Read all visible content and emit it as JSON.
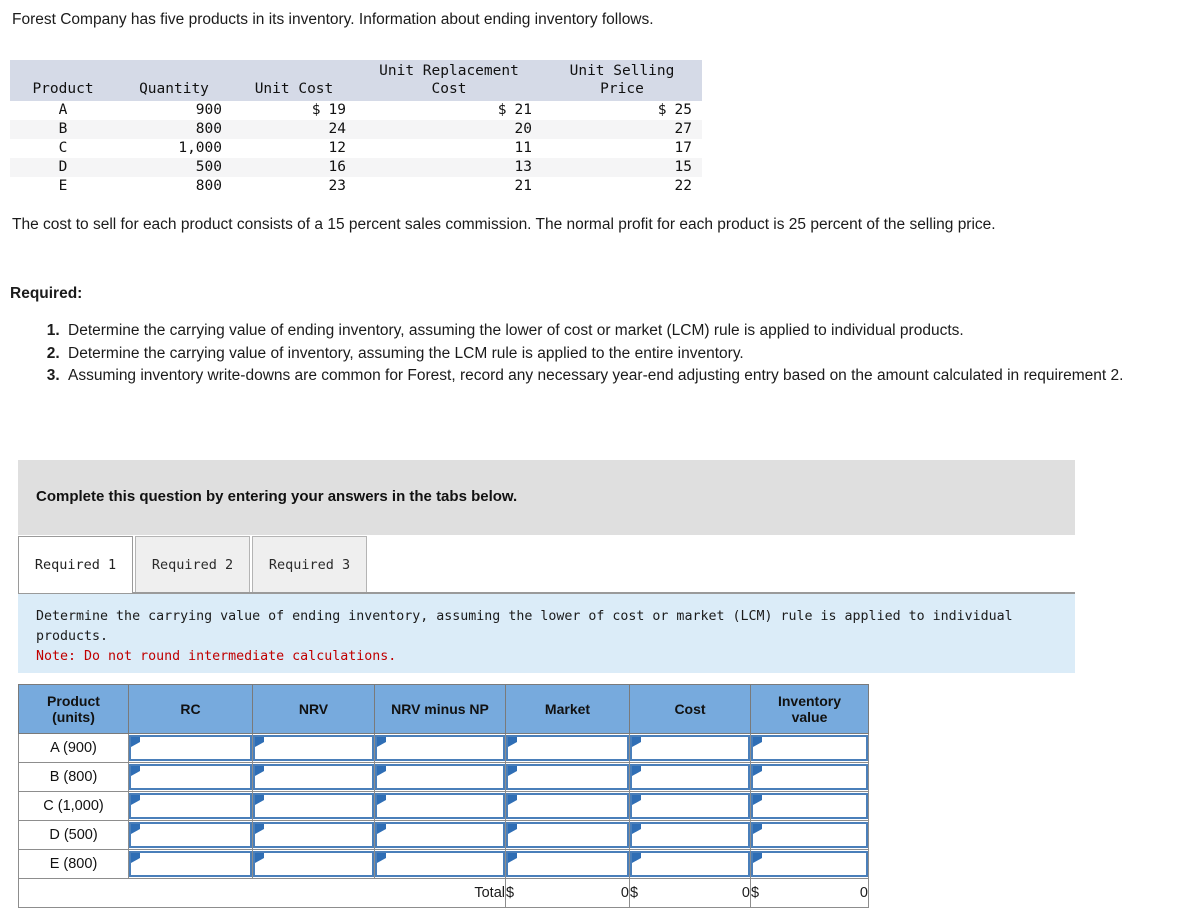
{
  "intro": "Forest Company has five products in its inventory. Information about ending inventory follows.",
  "inventory_table": {
    "headers": {
      "product": "Product",
      "quantity": "Quantity",
      "unit_cost": "Unit Cost",
      "unit_replacement_cost": "Unit Replacement Cost",
      "unit_selling_price": "Unit Selling Price"
    },
    "rows": [
      {
        "product": "A",
        "quantity": "900",
        "unit_cost": "19",
        "unit_cost_sym": "$",
        "rc": "21",
        "rc_sym": "$",
        "sp": "25",
        "sp_sym": "$"
      },
      {
        "product": "B",
        "quantity": "800",
        "unit_cost": "24",
        "unit_cost_sym": "",
        "rc": "20",
        "rc_sym": "",
        "sp": "27",
        "sp_sym": ""
      },
      {
        "product": "C",
        "quantity": "1,000",
        "unit_cost": "12",
        "unit_cost_sym": "",
        "rc": "11",
        "rc_sym": "",
        "sp": "17",
        "sp_sym": ""
      },
      {
        "product": "D",
        "quantity": "500",
        "unit_cost": "16",
        "unit_cost_sym": "",
        "rc": "13",
        "rc_sym": "",
        "sp": "15",
        "sp_sym": ""
      },
      {
        "product": "E",
        "quantity": "800",
        "unit_cost": "23",
        "unit_cost_sym": "",
        "rc": "21",
        "rc_sym": "",
        "sp": "22",
        "sp_sym": ""
      }
    ]
  },
  "cost_to_sell_paragraph": "The cost to sell for each product consists of a 15 percent sales commission. The normal profit for each product is 25 percent of the selling price.",
  "required_label": "Required:",
  "requirements": [
    "Determine the carrying value of ending inventory, assuming the lower of cost or market (LCM) rule is applied to individual products.",
    "Determine the carrying value of inventory, assuming the LCM rule is applied to the entire inventory.",
    "Assuming inventory write-downs are common for Forest, record any necessary year-end adjusting entry based on the amount calculated in requirement 2."
  ],
  "instruction_bar": {
    "text": "Complete this question by entering your answers in the tabs below."
  },
  "tabs": [
    {
      "label": "Required 1",
      "active": true
    },
    {
      "label": "Required 2",
      "active": false
    },
    {
      "label": "Required 3",
      "active": false
    }
  ],
  "note_panel": {
    "line1": "Determine the carrying value of ending inventory, assuming the lower of cost or market (LCM) rule is applied to individual",
    "line2": "products.",
    "note": "Note: Do not round intermediate calculations."
  },
  "answer_table": {
    "headers": {
      "product": "Product (units)",
      "product_line1": "Product",
      "product_line2": "(units)",
      "rc": "RC",
      "nrv": "NRV",
      "nrv_minus_np": "NRV minus NP",
      "market": "Market",
      "cost": "Cost",
      "inventory_value_line1": "Inventory",
      "inventory_value_line2": "value"
    },
    "rows": [
      {
        "product": "A (900)",
        "rc": "",
        "nrv": "",
        "nrv_minus_np": "",
        "market": "",
        "cost": "",
        "inventory_value": ""
      },
      {
        "product": "B (800)",
        "rc": "",
        "nrv": "",
        "nrv_minus_np": "",
        "market": "",
        "cost": "",
        "inventory_value": ""
      },
      {
        "product": "C (1,000)",
        "rc": "",
        "nrv": "",
        "nrv_minus_np": "",
        "market": "",
        "cost": "",
        "inventory_value": ""
      },
      {
        "product": "D (500)",
        "rc": "",
        "nrv": "",
        "nrv_minus_np": "",
        "market": "",
        "cost": "",
        "inventory_value": ""
      },
      {
        "product": "E (800)",
        "rc": "",
        "nrv": "",
        "nrv_minus_np": "",
        "market": "",
        "cost": "",
        "inventory_value": ""
      }
    ],
    "total": {
      "label": "Total",
      "market_symbol": "$",
      "market_value": "0",
      "cost_symbol": "$",
      "cost_value": "0",
      "inventory_symbol": "$",
      "inventory_value": "0"
    }
  },
  "colors": {
    "header_blue": "#77aadd",
    "note_panel_blue": "#dbecf8",
    "instruction_gray": "#dfdfdf",
    "data_header_gray": "#d5dae7",
    "note_red": "#c00000",
    "input_border_blue": "#4a7fba"
  }
}
